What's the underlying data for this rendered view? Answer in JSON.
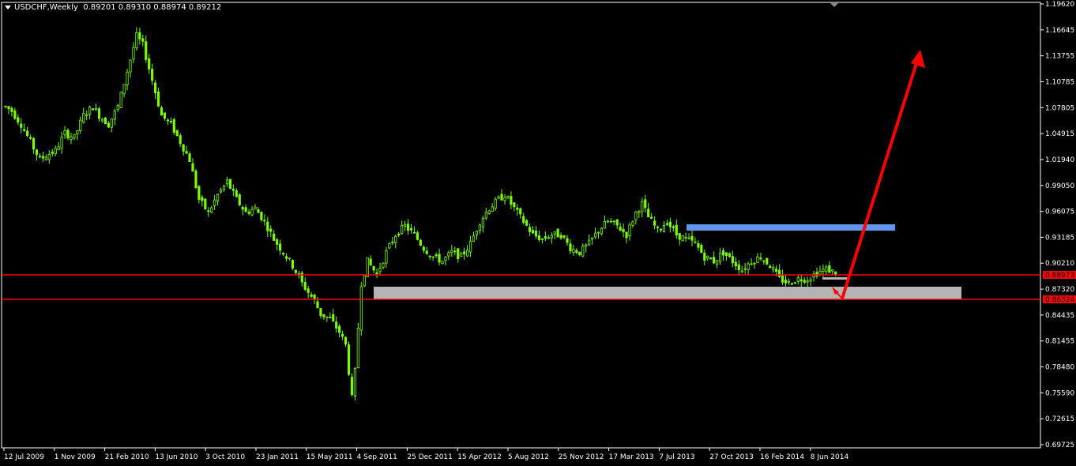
{
  "header": {
    "symbol": "USDCHF,Weekly",
    "ohlc": "0.89201 0.89310 0.88974 0.89212"
  },
  "price_axis": {
    "labels": [
      "1.19620",
      "1.16645",
      "1.13755",
      "1.10785",
      "1.07805",
      "1.04915",
      "1.01940",
      "0.99050",
      "0.96075",
      "0.93185",
      "0.90210",
      "0.87320",
      "0.84435",
      "0.81455",
      "0.78480",
      "0.75590",
      "0.72615",
      "0.69725"
    ]
  },
  "time_axis": {
    "labels": [
      "12 Jul 2009",
      "1 Nov 2009",
      "21 Feb 2010",
      "13 Jun 2010",
      "3 Oct 2010",
      "23 Jan 2011",
      "15 May 2011",
      "4 Sep 2011",
      "25 Dec 2011",
      "15 Apr 2012",
      "5 Aug 2012",
      "25 Nov 2012",
      "17 Mar 2013",
      "7 Jul 2013",
      "27 Oct 2013",
      "16 Feb 2014",
      "8 Jun 2014"
    ]
  },
  "levels": {
    "upper": "0.88973",
    "lower": "0.86324"
  },
  "colors": {
    "background": "#000000",
    "candles": "#7CFC00",
    "level_lines": "#FF0000",
    "blue_zone": "#6495ED",
    "grey_zone": "#B4B4B4",
    "arrow": "#FF0000",
    "axis_text": "#FFFFFF",
    "label_bg": "#FF0000"
  },
  "chart_data": {
    "type": "candlestick",
    "title": "USDCHF,Weekly",
    "ylim": [
      0.69725,
      1.1962
    ],
    "x": [
      "12 Jul 2009",
      "1 Nov 2009",
      "21 Feb 2010",
      "13 Jun 2010",
      "3 Oct 2010",
      "23 Jan 2011",
      "15 May 2011",
      "4 Sep 2011",
      "25 Dec 2011",
      "15 Apr 2012",
      "5 Aug 2012",
      "25 Nov 2012",
      "17 Mar 2013",
      "7 Jul 2013",
      "27 Oct 2013",
      "16 Feb 2014",
      "8 Jun 2014"
    ],
    "close_path": [
      [
        0,
        1.08
      ],
      [
        2,
        1.075
      ],
      [
        5,
        1.06
      ],
      [
        8,
        1.04
      ],
      [
        11,
        1.02
      ],
      [
        13,
        1.025
      ],
      [
        16,
        1.03
      ],
      [
        19,
        1.05
      ],
      [
        22,
        1.045
      ],
      [
        25,
        1.07
      ],
      [
        28,
        1.08
      ],
      [
        30,
        1.07
      ],
      [
        33,
        1.06
      ],
      [
        36,
        1.08
      ],
      [
        39,
        1.12
      ],
      [
        42,
        1.16
      ],
      [
        44,
        1.15
      ],
      [
        47,
        1.11
      ],
      [
        50,
        1.07
      ],
      [
        53,
        1.06
      ],
      [
        56,
        1.04
      ],
      [
        59,
        1.02
      ],
      [
        62,
        0.975
      ],
      [
        65,
        0.96
      ],
      [
        68,
        0.98
      ],
      [
        71,
        0.995
      ],
      [
        74,
        0.975
      ],
      [
        77,
        0.96
      ],
      [
        80,
        0.965
      ],
      [
        83,
        0.95
      ],
      [
        86,
        0.93
      ],
      [
        89,
        0.915
      ],
      [
        92,
        0.9
      ],
      [
        95,
        0.88
      ],
      [
        97,
        0.87
      ],
      [
        99,
        0.86
      ],
      [
        101,
        0.845
      ],
      [
        104,
        0.84
      ],
      [
        107,
        0.825
      ],
      [
        109,
        0.81
      ],
      [
        110,
        0.78
      ],
      [
        111,
        0.75
      ],
      [
        112,
        0.78
      ],
      [
        113,
        0.83
      ],
      [
        114,
        0.88
      ],
      [
        116,
        0.905
      ],
      [
        119,
        0.89
      ],
      [
        122,
        0.915
      ],
      [
        125,
        0.935
      ],
      [
        128,
        0.945
      ],
      [
        131,
        0.935
      ],
      [
        134,
        0.92
      ],
      [
        137,
        0.91
      ],
      [
        140,
        0.905
      ],
      [
        143,
        0.915
      ],
      [
        146,
        0.91
      ],
      [
        149,
        0.925
      ],
      [
        152,
        0.95
      ],
      [
        155,
        0.965
      ],
      [
        158,
        0.975
      ],
      [
        160,
        0.98
      ],
      [
        163,
        0.965
      ],
      [
        166,
        0.95
      ],
      [
        169,
        0.935
      ],
      [
        172,
        0.93
      ],
      [
        175,
        0.935
      ],
      [
        178,
        0.935
      ],
      [
        181,
        0.92
      ],
      [
        184,
        0.915
      ],
      [
        187,
        0.925
      ],
      [
        190,
        0.94
      ],
      [
        193,
        0.95
      ],
      [
        196,
        0.945
      ],
      [
        199,
        0.935
      ],
      [
        202,
        0.96
      ],
      [
        204,
        0.97
      ],
      [
        206,
        0.955
      ],
      [
        209,
        0.94
      ],
      [
        212,
        0.95
      ],
      [
        215,
        0.935
      ],
      [
        218,
        0.93
      ],
      [
        221,
        0.925
      ],
      [
        224,
        0.91
      ],
      [
        227,
        0.905
      ],
      [
        230,
        0.915
      ],
      [
        233,
        0.905
      ],
      [
        236,
        0.895
      ],
      [
        239,
        0.905
      ],
      [
        242,
        0.91
      ],
      [
        245,
        0.9
      ],
      [
        248,
        0.885
      ],
      [
        251,
        0.88
      ],
      [
        254,
        0.885
      ],
      [
        257,
        0.885
      ],
      [
        260,
        0.892
      ],
      [
        263,
        0.896
      ],
      [
        266,
        0.892
      ]
    ]
  }
}
